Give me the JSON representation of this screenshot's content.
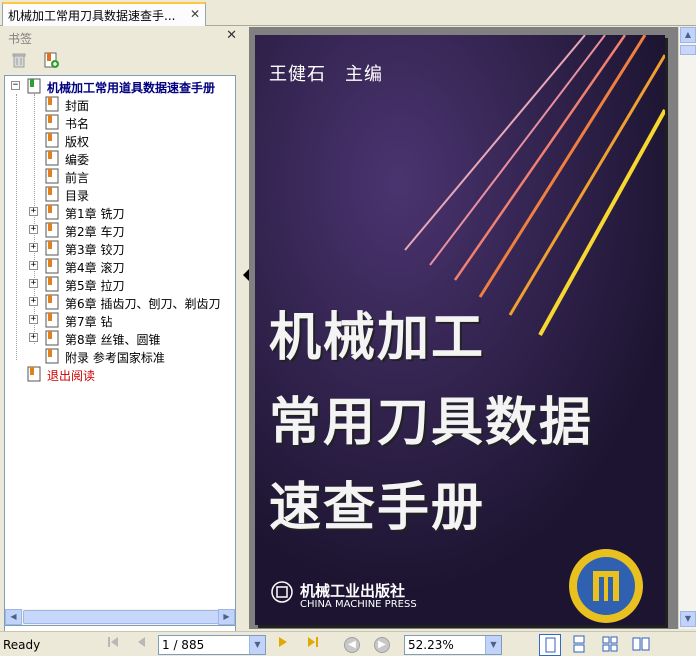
{
  "tab": {
    "title": "机械加工常用刀具数据速查手...",
    "close": "✕"
  },
  "panel": {
    "title": "书签",
    "close": "✕"
  },
  "bookmarks": {
    "root": "机械加工常用道具数据速查手册",
    "items": [
      "封面",
      "书名",
      "版权",
      "编委",
      "前言",
      "目录",
      "第1章 铣刀",
      "第2章 车刀",
      "第3章 铰刀",
      "第4章 滚刀",
      "第5章 拉刀",
      "第6章 插齿刀、刨刀、剃齿刀",
      "第7章 钻",
      "第8章 丝锥、圆锥",
      "附录 参考国家标准"
    ],
    "exit": "退出阅读"
  },
  "cover": {
    "author": "王健石　主编",
    "title_line1": "机械加工",
    "title_line2": "常用刀具数据",
    "title_line3": "速查手册",
    "publisher_cn": "机械工业出版社",
    "publisher_en": "CHINA MACHINE PRESS"
  },
  "status": {
    "text": "Ready",
    "page": "1 / 885",
    "zoom": "52.23%"
  },
  "colors": {
    "exit": "#cc0000",
    "root": "#000080",
    "cover_bg": "#2a1e44",
    "accent_tab": "#ffc83c"
  }
}
